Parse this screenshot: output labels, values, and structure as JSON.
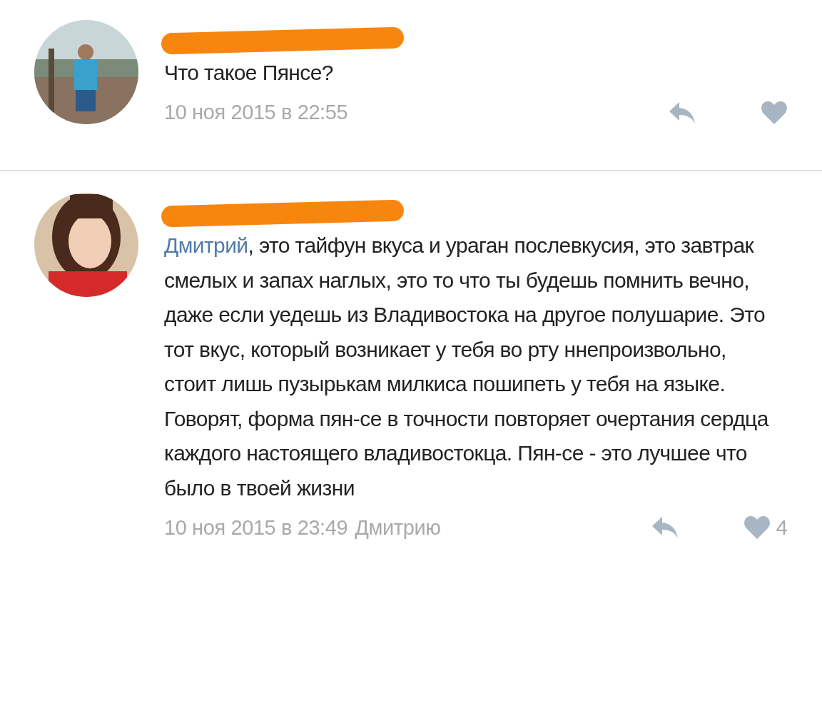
{
  "comments": [
    {
      "name_redacted": true,
      "text": "Что такое Пянсе?",
      "date": "10 ноя 2015 в 22:55"
    },
    {
      "name_redacted": true,
      "mention": "Дмитрий",
      "text": ", это тайфун вкуса и ураган послевкусия, это завтрак смелых и запах наглых, это то что ты будешь помнить вечно, даже если уедешь из Владивостока на другое полушарие. Это тот вкус, который возникает у тебя во рту ннепроизвольно, стоит лишь пузырькам милкиса пошипеть у тебя на языке. Говорят, форма пян-се в точности повторяет очертания сердца каждого настоящего владивостокца. Пян-се - это лучшее что было в твоей жизни",
      "date": "10 ноя 2015 в 23:49",
      "reply_to": "Дмитрию",
      "likes": "4"
    }
  ]
}
